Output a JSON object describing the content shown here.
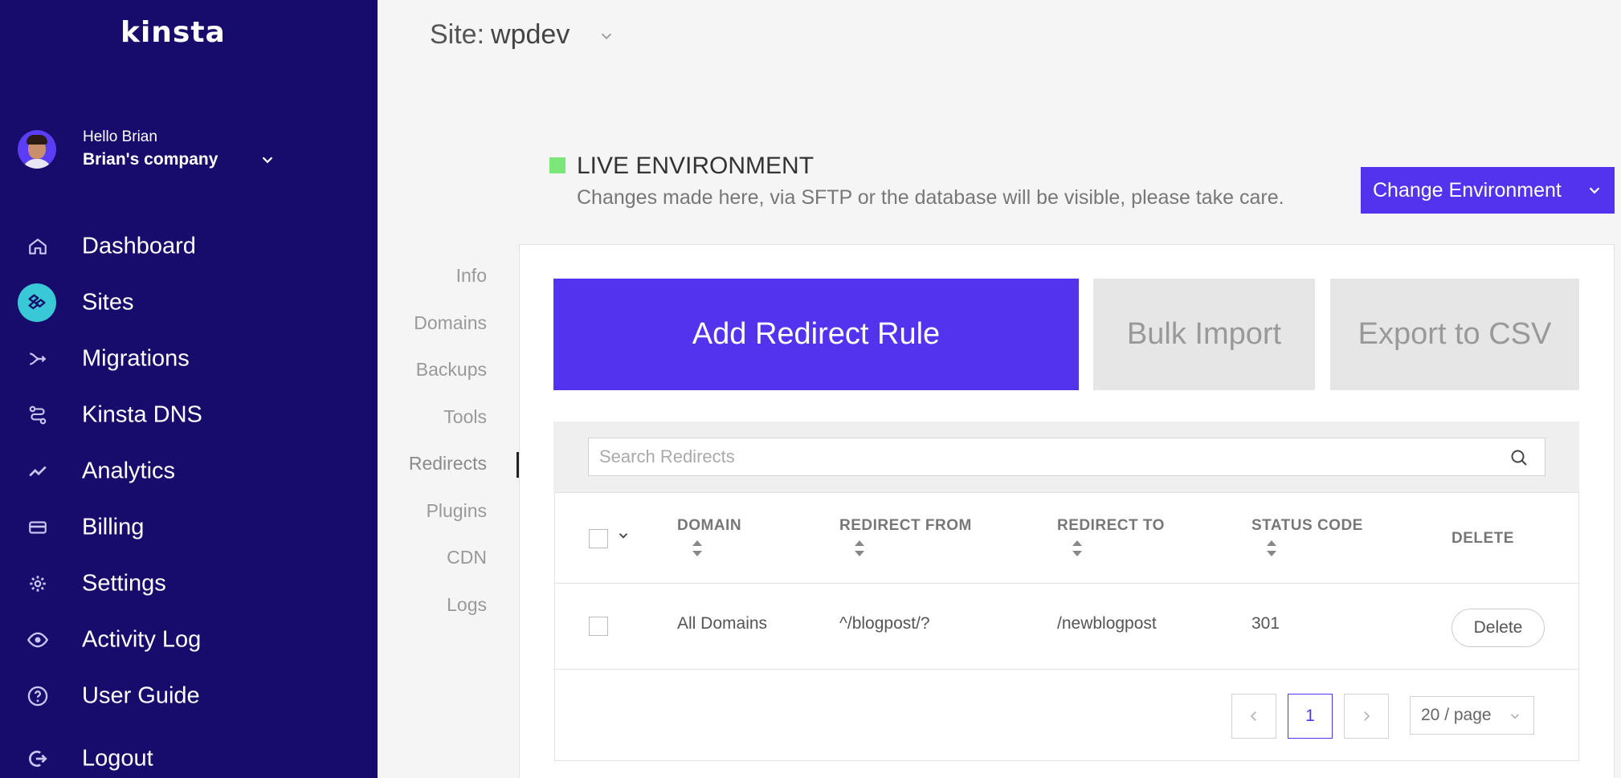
{
  "sidebar": {
    "logo": "kinsta",
    "user": {
      "greeting": "Hello Brian",
      "company": "Brian's company"
    },
    "items": [
      {
        "label": "Dashboard",
        "icon": "home-icon"
      },
      {
        "label": "Sites",
        "icon": "sites-icon",
        "active": true
      },
      {
        "label": "Migrations",
        "icon": "migrations-icon"
      },
      {
        "label": "Kinsta DNS",
        "icon": "dns-icon"
      },
      {
        "label": "Analytics",
        "icon": "analytics-icon"
      },
      {
        "label": "Billing",
        "icon": "billing-icon"
      },
      {
        "label": "Settings",
        "icon": "gear-icon"
      },
      {
        "label": "Activity Log",
        "icon": "eye-icon"
      },
      {
        "label": "User Guide",
        "icon": "help-icon"
      },
      {
        "label": "Logout",
        "icon": "logout-icon"
      }
    ]
  },
  "header": {
    "site_prefix": "Site:",
    "site_name": "wpdev"
  },
  "environment": {
    "title": "LIVE ENVIRONMENT",
    "description": "Changes made here, via SFTP or the database will be visible, please take care.",
    "change_label": "Change Environment",
    "indicator_color": "#7be77b"
  },
  "subnav": {
    "items": [
      "Info",
      "Domains",
      "Backups",
      "Tools",
      "Redirects",
      "Plugins",
      "CDN",
      "Logs"
    ],
    "active": "Redirects"
  },
  "actions": {
    "add": "Add Redirect Rule",
    "bulk": "Bulk Import",
    "export": "Export to CSV"
  },
  "search": {
    "placeholder": "Search Redirects",
    "value": ""
  },
  "table": {
    "columns": [
      "DOMAIN",
      "REDIRECT FROM",
      "REDIRECT TO",
      "STATUS CODE",
      "DELETE"
    ],
    "rows": [
      {
        "domain": "All Domains",
        "from": "^/blogpost/?",
        "to": "/newblogpost",
        "status": "301",
        "delete_label": "Delete"
      }
    ]
  },
  "pagination": {
    "current_page": "1",
    "page_size": "20 / page"
  },
  "colors": {
    "sidebar_bg": "#170c6b",
    "accent": "#5333ed",
    "active_icon_bg": "#39c9d6"
  }
}
